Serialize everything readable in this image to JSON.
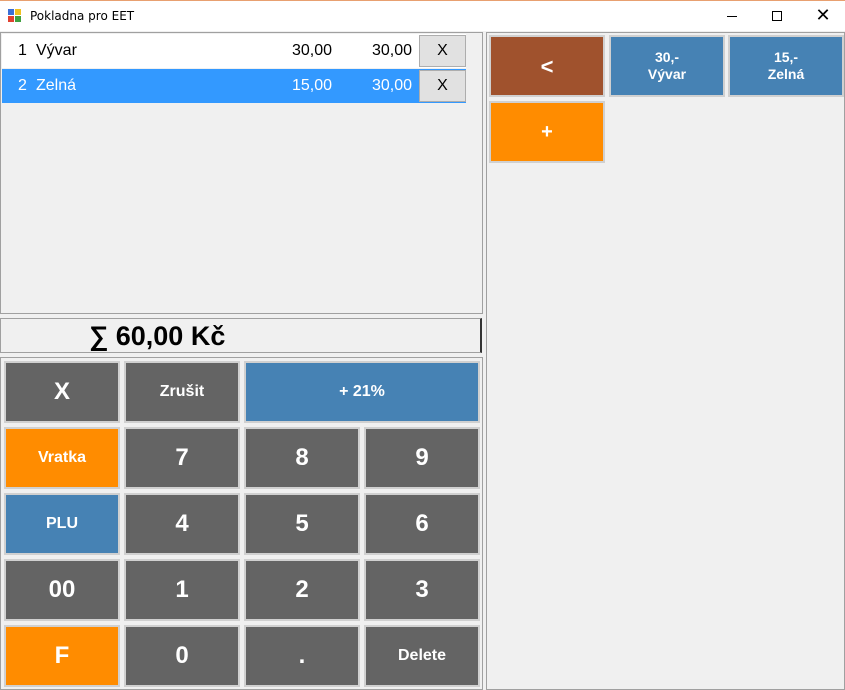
{
  "window": {
    "title": "Pokladna pro EET",
    "minimize": "",
    "maximize": "",
    "close": "✕"
  },
  "items": [
    {
      "num": "1",
      "name": "Vývar",
      "price": "30,00",
      "total": "30,00",
      "remove_label": "X",
      "selected": false
    },
    {
      "num": "2",
      "name": "Zelná",
      "price": "15,00",
      "total": "30,00",
      "remove_label": "X",
      "selected": true
    }
  ],
  "sum": {
    "text": "∑ 60,00 Kč"
  },
  "keypad": {
    "clear": "X",
    "cancel": "Zrušit",
    "vat": "+ 21%",
    "refund": "Vratka",
    "plu": "PLU",
    "k7": "7",
    "k8": "8",
    "k9": "9",
    "k4": "4",
    "k5": "5",
    "k6": "6",
    "k00": "00",
    "k1": "1",
    "k2": "2",
    "k3": "3",
    "f": "F",
    "k0": "0",
    "dot": ".",
    "delete": "Delete"
  },
  "plu_panel": {
    "back": "<",
    "items": [
      {
        "price": "30,-",
        "name": "Vývar"
      },
      {
        "price": "15,-",
        "name": "Zelná"
      }
    ],
    "add": "+"
  },
  "colors": {
    "gray_key": "#646464",
    "orange_key": "#ff8c00",
    "blue_key": "#4682b4",
    "brown_key": "#a0522d",
    "selection": "#3399ff"
  }
}
